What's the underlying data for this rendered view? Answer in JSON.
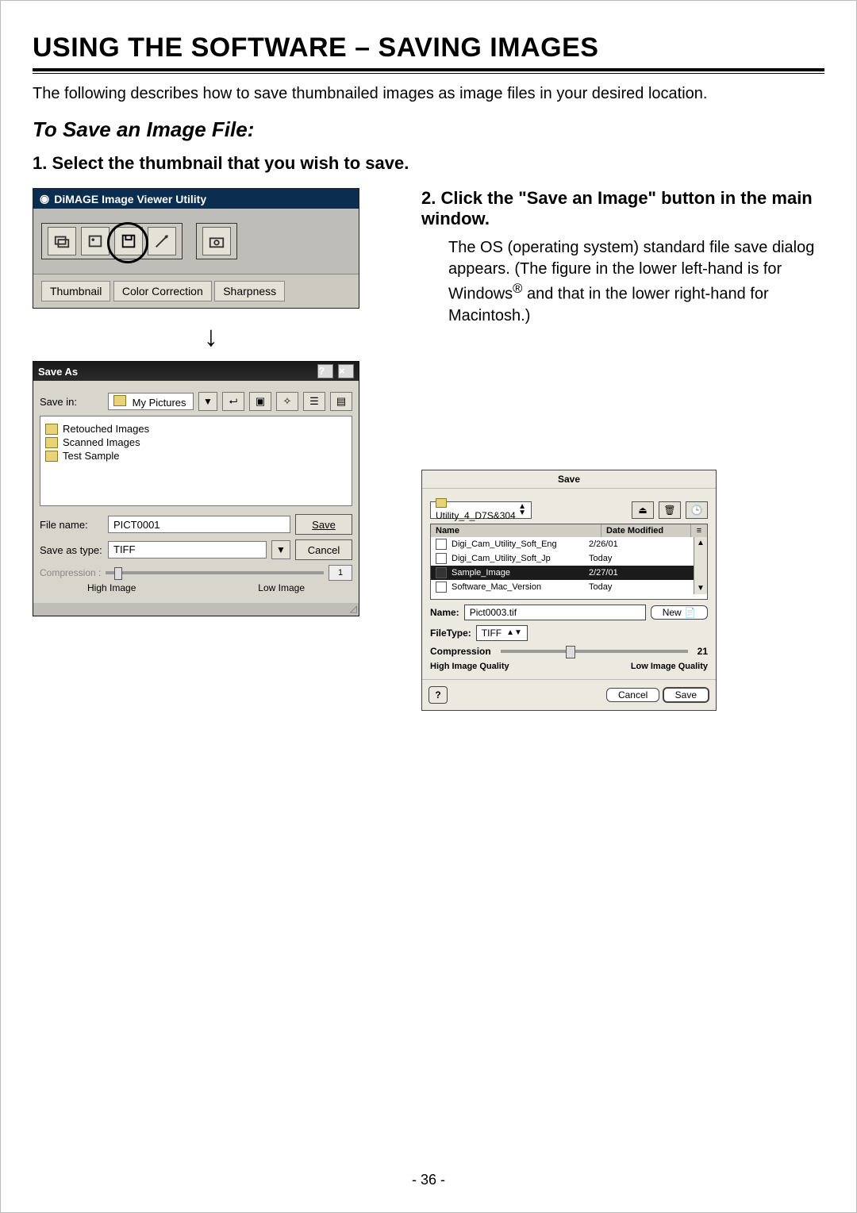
{
  "heading": "USING THE SOFTWARE – SAVING IMAGES",
  "intro": "The following describes how to save thumbnailed images as image files in your desired location.",
  "subhead": "To Save an Image File:",
  "step1": "1.  Select the thumbnail that you wish to save.",
  "step2": "2.  Click the \"Save an Image\" button in the main window.",
  "step2_body_a": "The OS (operating system) standard file save dialog appears. (The figure in the lower left-hand is for Windows",
  "step2_body_b": " and that in the lower right-hand for Macintosh.)",
  "reg_mark": "®",
  "app_window": {
    "title": "DiMAGE Image Viewer Utility",
    "tabs": [
      "Thumbnail",
      "Color Correction",
      "Sharpness"
    ]
  },
  "win_dialog": {
    "title": "Save As",
    "save_in_label": "Save in:",
    "save_in_value": "My Pictures",
    "folders": [
      "Retouched Images",
      "Scanned Images",
      "Test Sample"
    ],
    "file_name_label": "File name:",
    "file_name_value": "PICT0001",
    "save_type_label": "Save as type:",
    "save_type_value": "TIFF",
    "save_btn": "Save",
    "cancel_btn": "Cancel",
    "compression_label": "Compression :",
    "compression_value": "1",
    "high": "High Image",
    "low": "Low Image"
  },
  "mac_dialog": {
    "title": "Save",
    "location": "Utility_4_D7S&304",
    "col_name": "Name",
    "col_date": "Date Modified",
    "items": [
      {
        "name": "Digi_Cam_Utility_Soft_Eng",
        "date": "2/26/01",
        "selected": false
      },
      {
        "name": "Digi_Cam_Utility_Soft_Jp",
        "date": "Today",
        "selected": false
      },
      {
        "name": "Sample_Image",
        "date": "2/27/01",
        "selected": true
      },
      {
        "name": "Software_Mac_Version",
        "date": "Today",
        "selected": false
      }
    ],
    "name_label": "Name:",
    "name_value": "Pict0003.tif",
    "new_btn": "New",
    "filetype_label": "FileType:",
    "filetype_value": "TIFF",
    "compression_label": "Compression",
    "compression_value": "21",
    "high": "High Image Quality",
    "low": "Low Image Quality",
    "cancel_btn": "Cancel",
    "save_btn": "Save"
  },
  "page_number": "- 36 -"
}
